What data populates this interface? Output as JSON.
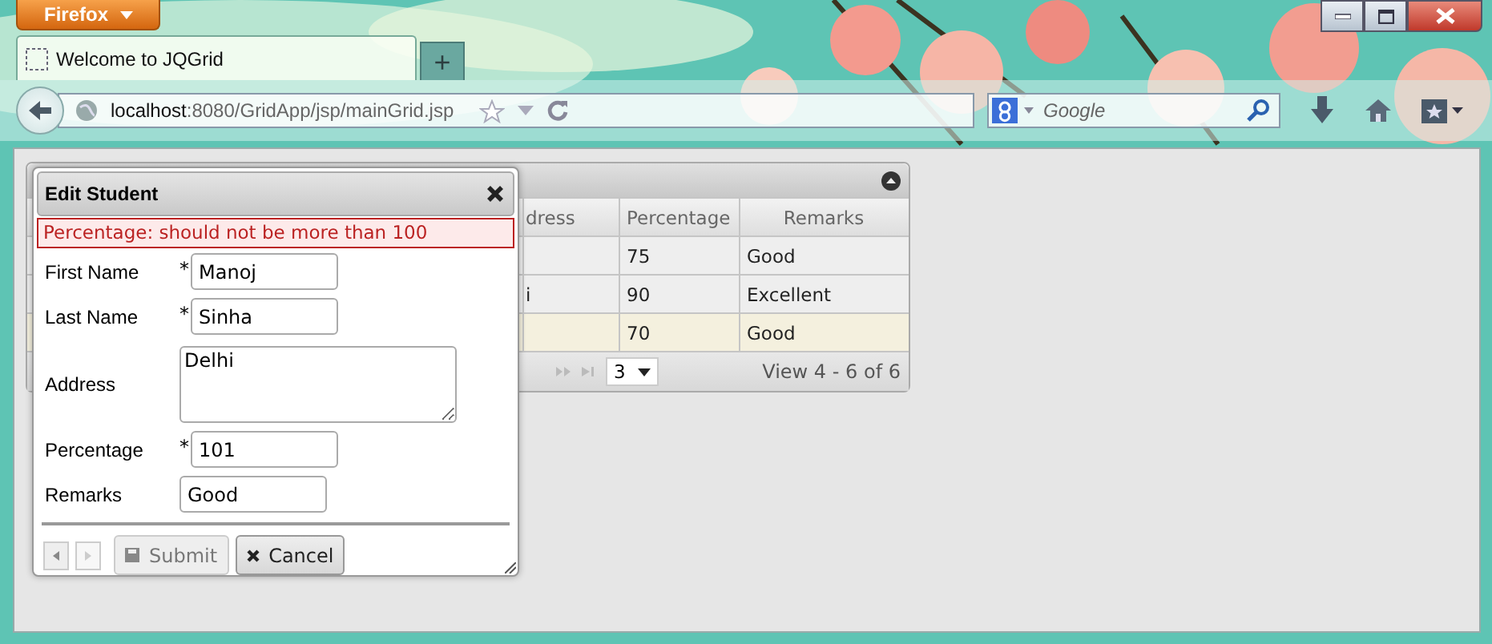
{
  "browser": {
    "menu_button": "Firefox",
    "tabs": [
      {
        "title": "Welcome to JQGrid",
        "selected": true
      }
    ],
    "new_tab": "+",
    "url_host": "localhost",
    "url_rest": ":8080/GridApp/jsp/mainGrid.jsp",
    "search": {
      "placeholder": "Google"
    }
  },
  "grid": {
    "columns": [
      {
        "label": "dress"
      },
      {
        "label": "Percentage"
      },
      {
        "label": "Remarks"
      }
    ],
    "rows": [
      {
        "selected": false,
        "cells": [
          "",
          "75",
          "Good"
        ]
      },
      {
        "selected": false,
        "cells": [
          "i",
          "90",
          "Excellent"
        ]
      },
      {
        "selected": true,
        "cells": [
          "",
          "70",
          "Good"
        ]
      }
    ],
    "pager": {
      "page_size": "3",
      "view": "View 4 - 6 of 6"
    }
  },
  "dialog": {
    "title": "Edit Student",
    "error": "Percentage: should not be more than 100",
    "fields": [
      {
        "label": "First Name",
        "required_mark": "*",
        "kind": "input",
        "value": "Manoj"
      },
      {
        "label": "Last Name",
        "required_mark": "*",
        "kind": "input",
        "value": "Sinha"
      },
      {
        "label": "Address",
        "kind": "textarea",
        "value": "Delhi"
      },
      {
        "label": "Percentage",
        "required_mark": "*",
        "kind": "input",
        "value": "101"
      },
      {
        "label": "Remarks",
        "kind": "input",
        "value": "Good"
      }
    ],
    "buttons": [
      {
        "kind": "submit",
        "label": "Submit",
        "disabled": true
      },
      {
        "kind": "cancel",
        "label": "Cancel",
        "disabled": false
      }
    ]
  }
}
